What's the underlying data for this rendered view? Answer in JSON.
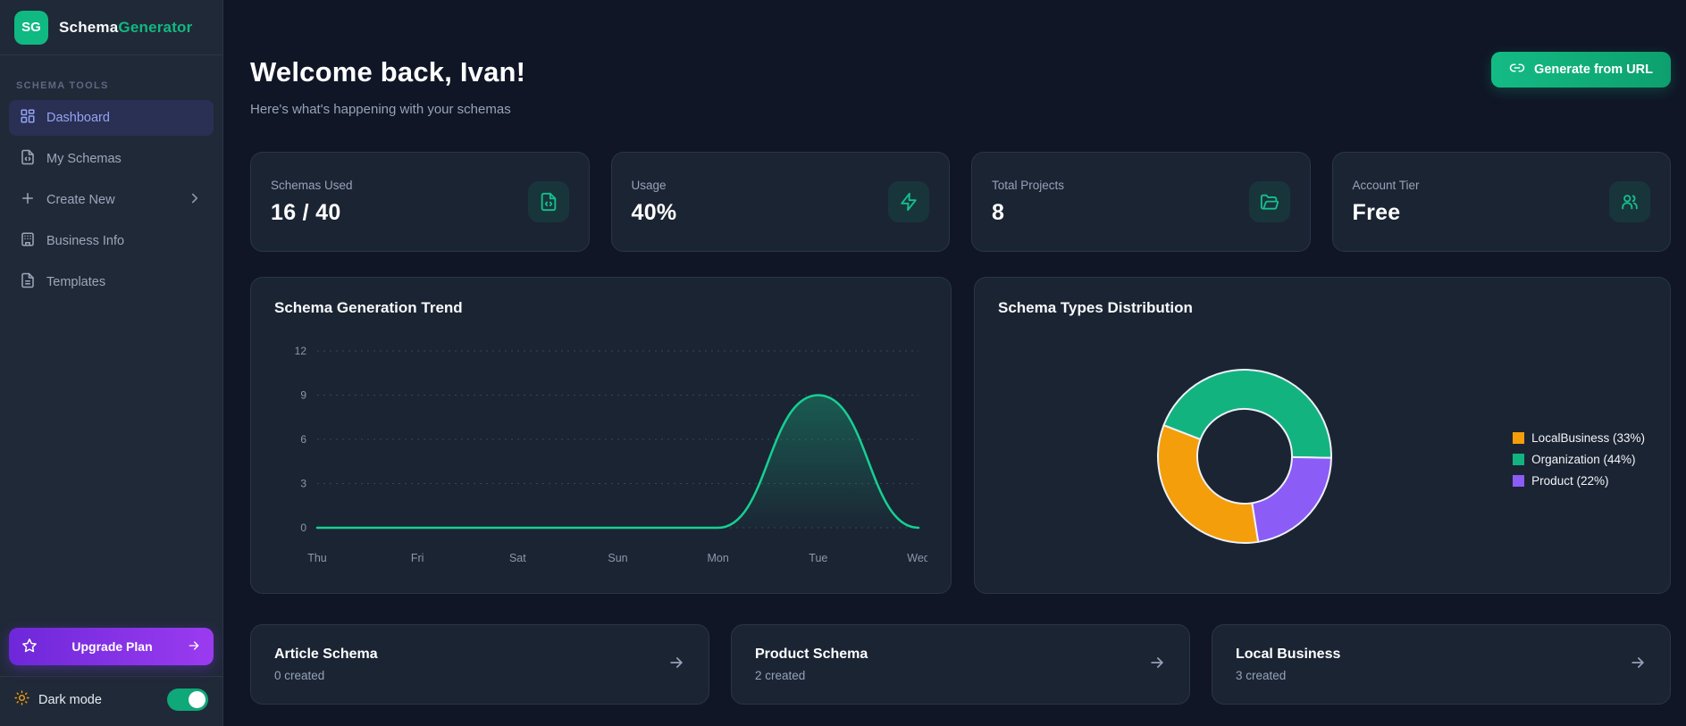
{
  "app": {
    "logo_initials": "SG",
    "name_primary": "Schema",
    "name_secondary": "Generator"
  },
  "sidebar": {
    "section_label": "SCHEMA TOOLS",
    "items": [
      {
        "label": "Dashboard",
        "icon": "dashboard-grid-icon",
        "active": true
      },
      {
        "label": "My Schemas",
        "icon": "file-code-icon",
        "active": false
      },
      {
        "label": "Create New",
        "icon": "plus-icon",
        "active": false,
        "has_chevron": true
      },
      {
        "label": "Business Info",
        "icon": "building-icon",
        "active": false
      },
      {
        "label": "Templates",
        "icon": "file-text-icon",
        "active": false
      }
    ],
    "upgrade_label": "Upgrade Plan",
    "dark_mode_label": "Dark mode",
    "dark_mode_on": true
  },
  "header": {
    "title": "Welcome back, Ivan!",
    "subtitle": "Here's what's happening with your schemas",
    "generate_button_label": "Generate from URL"
  },
  "stats": [
    {
      "label": "Schemas Used",
      "value": "16 / 40",
      "icon": "file-code-icon"
    },
    {
      "label": "Usage",
      "value": "40%",
      "icon": "zap-icon"
    },
    {
      "label": "Total Projects",
      "value": "8",
      "icon": "folder-open-icon"
    },
    {
      "label": "Account Tier",
      "value": "Free",
      "icon": "users-icon"
    }
  ],
  "chart_data": [
    {
      "type": "line",
      "title": "Schema Generation Trend",
      "x": [
        "Thu",
        "Fri",
        "Sat",
        "Sun",
        "Mon",
        "Tue",
        "Wed"
      ],
      "values": [
        0,
        0,
        0,
        0,
        0,
        9,
        0
      ],
      "ylim": [
        0,
        12
      ],
      "yticks": [
        0,
        3,
        6,
        9,
        12
      ],
      "grid": "dotted-horizontal",
      "legend_position": "none",
      "line_color": "#17cf92"
    },
    {
      "type": "pie",
      "title": "Schema Types Distribution",
      "donut": true,
      "start_angle_deg": -69,
      "legend_position": "right",
      "series": [
        {
          "name": "LocalBusiness",
          "pct": 33,
          "color": "#f59e0b"
        },
        {
          "name": "Organization",
          "pct": 44,
          "color": "#13b380"
        },
        {
          "name": "Product",
          "pct": 22,
          "color": "#8b5cf6"
        }
      ],
      "draw_order": [
        "Organization",
        "Product",
        "LocalBusiness"
      ],
      "border_color": "#edf1f7"
    }
  ],
  "quick_cards": [
    {
      "title": "Article Schema",
      "subtitle": "0 created"
    },
    {
      "title": "Product Schema",
      "subtitle": "2 created"
    },
    {
      "title": "Local Business",
      "subtitle": "3 created"
    }
  ],
  "colors": {
    "accent_green": "#10b981",
    "active_nav_text": "#93a3f2",
    "upgrade_gradient_start": "#6d28d9",
    "upgrade_gradient_end": "#9b3bf0",
    "page_bg": "#101626",
    "sidebar_bg": "#202938",
    "card_bg": "#1b2433",
    "sun_icon": "#f59e0b"
  }
}
